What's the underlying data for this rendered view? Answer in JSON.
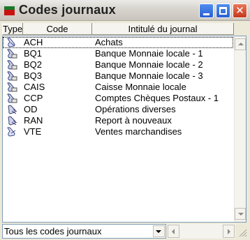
{
  "window": {
    "title": "Codes journaux",
    "accent": "#c81212"
  },
  "columns": {
    "type": "Type",
    "code": "Code",
    "intitule": "Intitulé du journal"
  },
  "rows": [
    {
      "icon": "purchases-journal-icon",
      "code": "ACH",
      "intitule": "Achats"
    },
    {
      "icon": "bank-journal-icon",
      "code": "BQ1",
      "intitule": "Banque Monnaie locale - 1"
    },
    {
      "icon": "bank-journal-icon",
      "code": "BQ2",
      "intitule": "Banque Monnaie locale - 2"
    },
    {
      "icon": "bank-journal-icon",
      "code": "BQ3",
      "intitule": "Banque Monnaie locale - 3"
    },
    {
      "icon": "bank-journal-icon",
      "code": "CAIS",
      "intitule": "Caisse Monnaie locale"
    },
    {
      "icon": "bank-journal-icon",
      "code": "CCP",
      "intitule": "Comptes Chèques Postaux - 1"
    },
    {
      "icon": "general-journal-icon",
      "code": "OD",
      "intitule": "Opérations diverses"
    },
    {
      "icon": "general-journal-icon",
      "code": "RAN",
      "intitule": "Report à nouveaux"
    },
    {
      "icon": "sales-journal-icon",
      "code": "VTE",
      "intitule": "Ventes marchandises"
    }
  ],
  "filter": {
    "selected": "Tous les codes journaux"
  }
}
